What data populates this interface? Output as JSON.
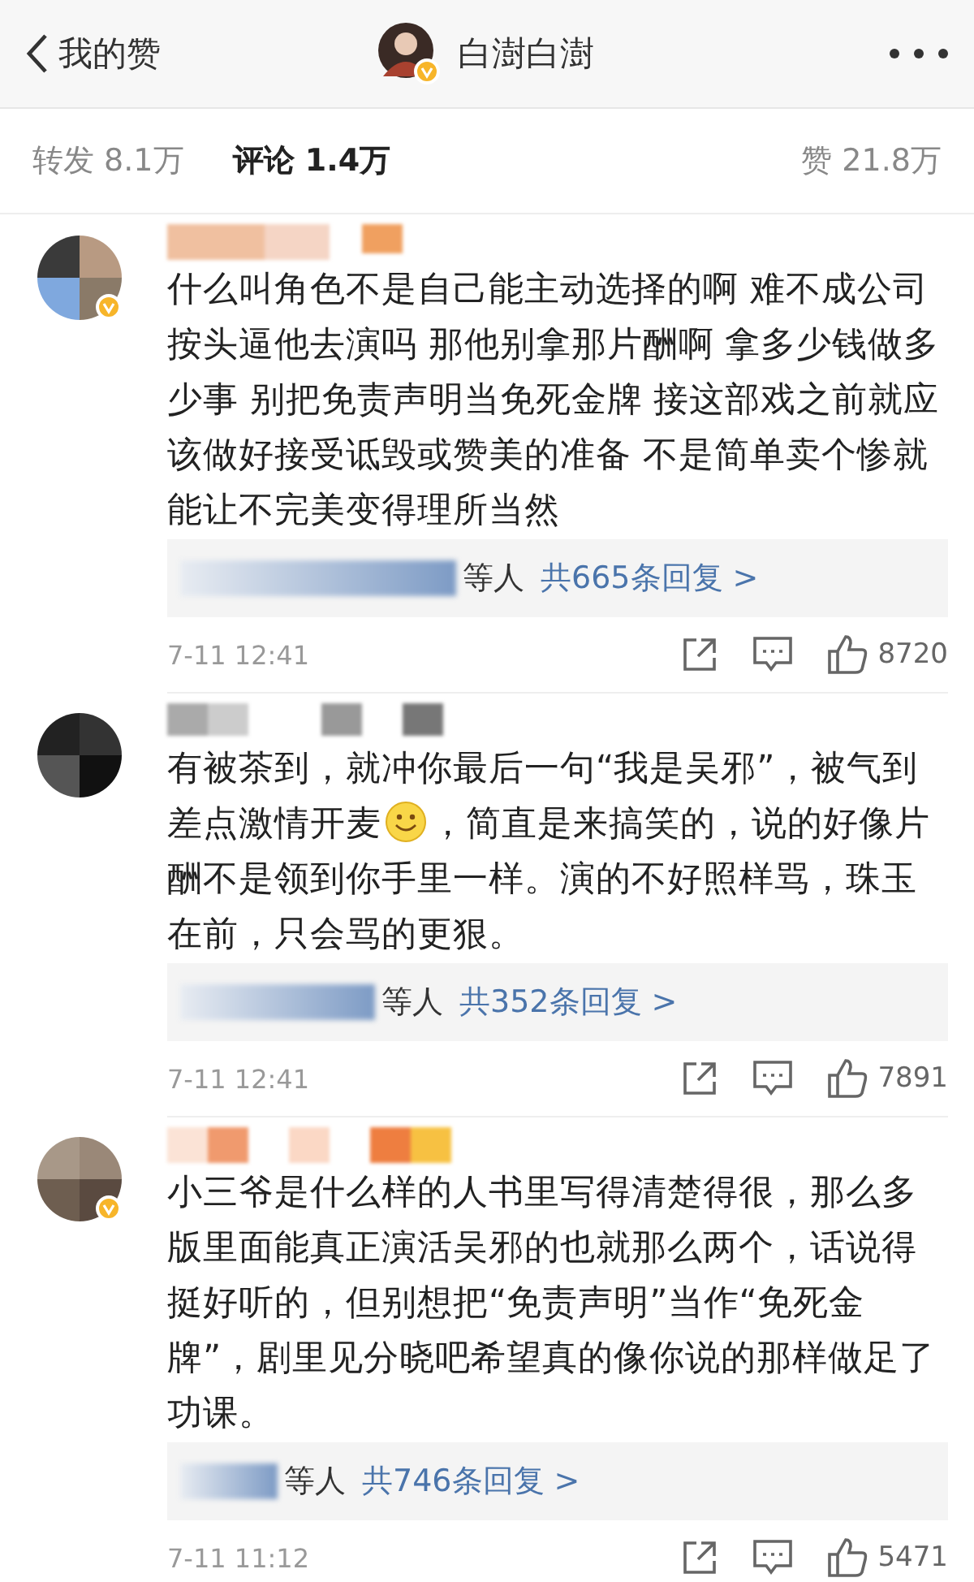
{
  "nav": {
    "back_label": "我的赞",
    "title": "白澍白澍",
    "verified": true
  },
  "tabs": [
    {
      "label": "转发 8.1万",
      "selected": false
    },
    {
      "label": "评论 1.4万",
      "selected": true
    },
    {
      "label": "赞 21.8万",
      "selected": false
    }
  ],
  "comments": [
    {
      "verified": true,
      "segments": [
        {
          "kind": "text",
          "text": "什么叫角色不是自己能主动选择的啊 难不成公司按头逼他去演吗 那他别拿那片酬啊 拿多少钱做多少事 别把免责声明当免死金牌 接这部戏之前就应该做好接受诋毁或赞美的准备 不是简单卖个惨就能让不完美变得理所当然"
        }
      ],
      "replies_suffix": "等人",
      "replies_link": "共665条回复 >",
      "time": "7-11 12:41",
      "likes": "8720"
    },
    {
      "verified": false,
      "segments": [
        {
          "kind": "text",
          "text": "有被茶到，就冲你最后一句“我是吴邪”，被气到差点激情开麦"
        },
        {
          "kind": "emoji"
        },
        {
          "kind": "text",
          "text": "，简直是来搞笑的，说的好像片酬不是领到你手里一样。演的不好照样骂，珠玉在前，只会骂的更狠。"
        }
      ],
      "replies_suffix": "等人",
      "replies_link": "共352条回复 >",
      "time": "7-11 12:41",
      "likes": "7891"
    },
    {
      "verified": true,
      "segments": [
        {
          "kind": "text",
          "text": "小三爷是什么样的人书里写得清楚得很，那么多版里面能真正演活吴邪的也就那么两个，话说得挺好听的，但别想把“免责声明”当作“免死金牌”，剧里见分晓吧希望真的像你说的那样做足了功课。"
        }
      ],
      "replies_suffix": "等人",
      "replies_link": "共746条回复 >",
      "time": "7-11 11:12",
      "likes": "5471"
    }
  ]
}
